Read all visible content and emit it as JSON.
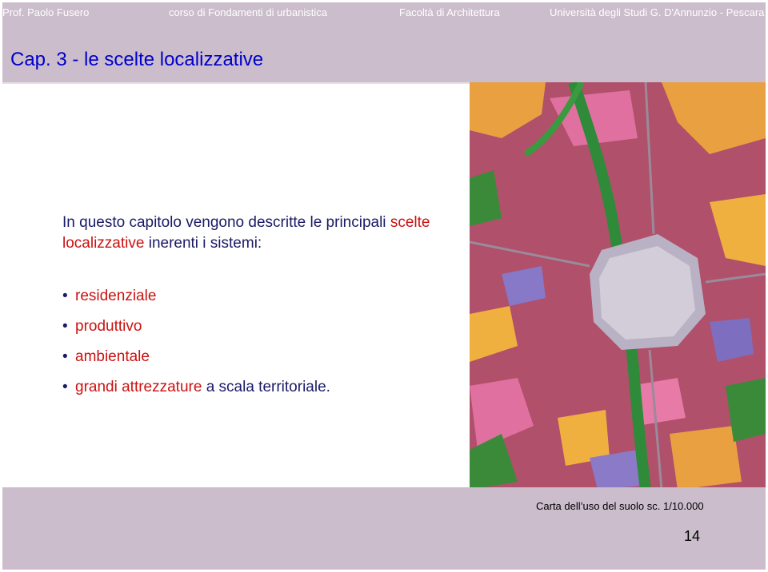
{
  "header": {
    "author": "Prof. Paolo Fusero",
    "course": "corso di Fondamenti di urbanistica",
    "faculty": "Facoltà di Architettura",
    "university": "Università degli Studi G. D'Annunzio - Pescara"
  },
  "title": "Cap. 3 - le scelte localizzative",
  "intro": {
    "part1": "In questo capitolo vengono descritte le principali ",
    "highlight": "scelte localizzative",
    "part2": " inerenti i sistemi:"
  },
  "bullets": [
    {
      "text": "residenziale",
      "tail": ""
    },
    {
      "text": "produttivo",
      "tail": ""
    },
    {
      "text": "ambientale",
      "tail": ""
    },
    {
      "text": "grandi attrezzature",
      "tail": " a scala territoriale."
    }
  ],
  "map_caption": "Carta dell’uso del suolo sc. 1/10.000",
  "page_number": "14",
  "colors": {
    "header_bg": "#cbbdcb",
    "title": "#0000cc",
    "body_text": "#1a1a66",
    "highlight": "#cc1111"
  }
}
